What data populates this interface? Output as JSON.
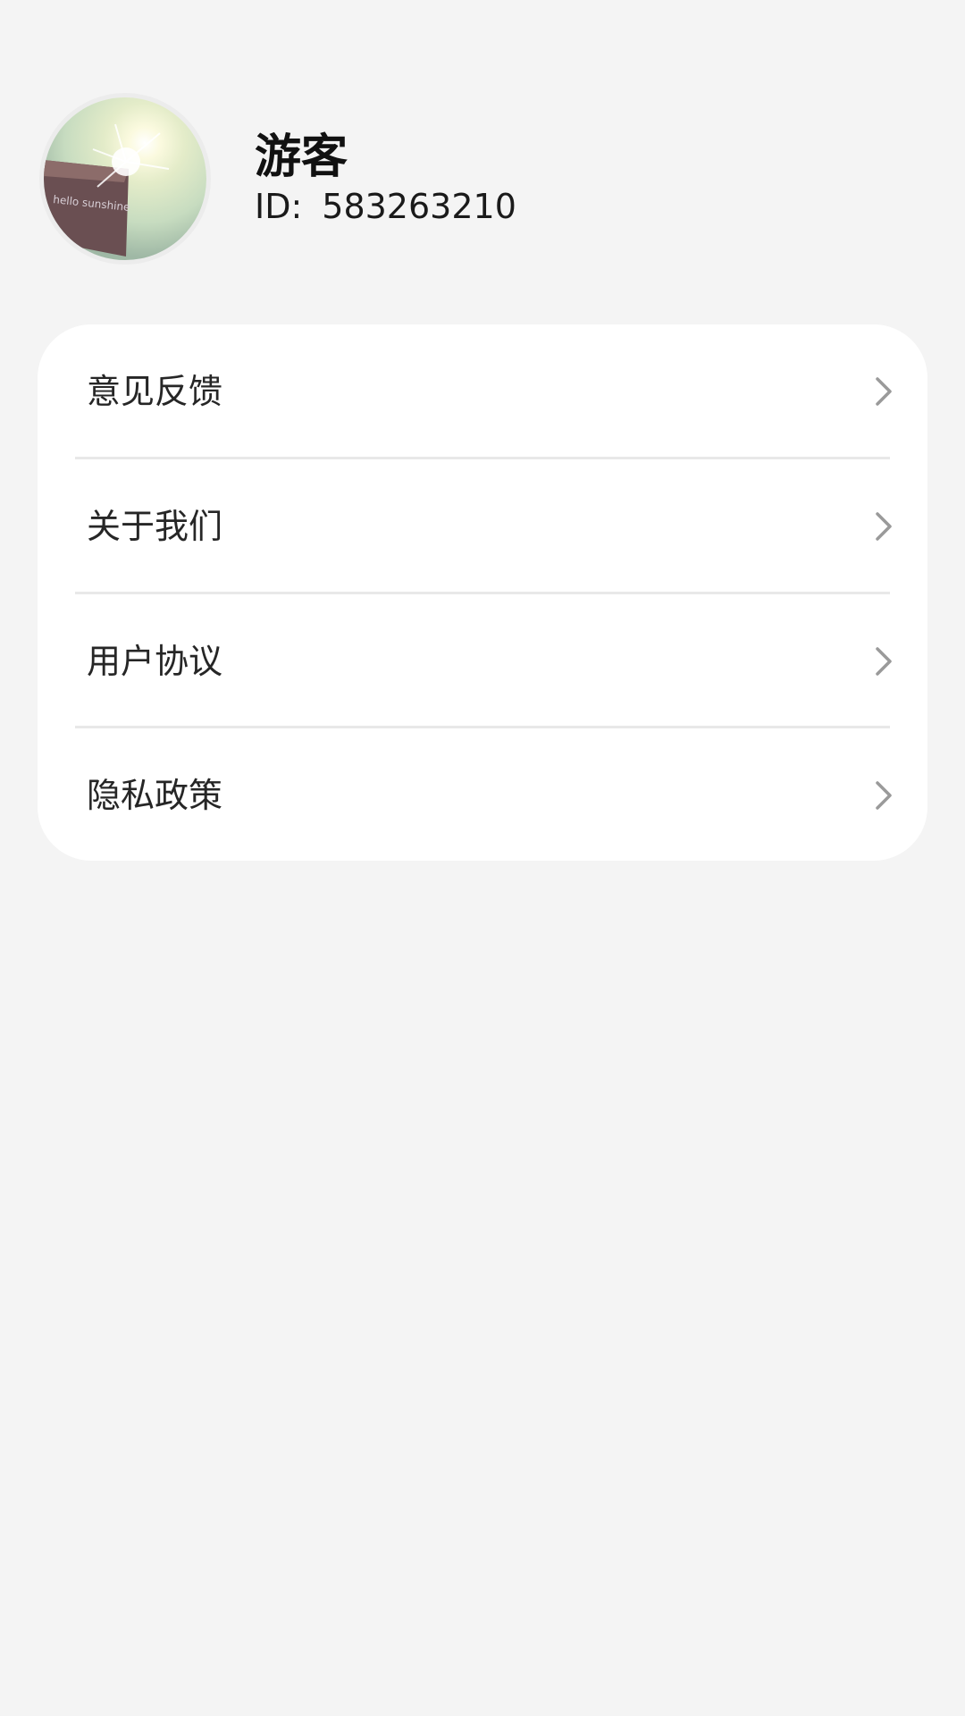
{
  "profile": {
    "name": "游客",
    "id_label": "ID:",
    "id_value": "583263210",
    "avatar_text": "hello sunshine"
  },
  "menu": {
    "items": [
      {
        "label": "意见反馈",
        "icon": "chevron-right-icon"
      },
      {
        "label": "关于我们",
        "icon": "chevron-right-icon"
      },
      {
        "label": "用户协议",
        "icon": "chevron-right-icon"
      },
      {
        "label": "隐私政策",
        "icon": "chevron-right-icon"
      }
    ]
  },
  "colors": {
    "background": "#f4f4f4",
    "card": "#ffffff",
    "divider": "#e8e8e8",
    "chevron": "#9a9a9a"
  }
}
